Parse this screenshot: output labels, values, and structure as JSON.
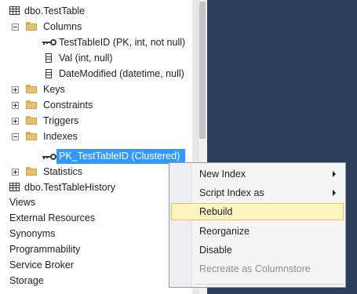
{
  "tree": {
    "table_name": "dbo.TestTable",
    "columns_folder": "Columns",
    "columns": [
      "TestTableID (PK, int, not null)",
      "Val (int, null)",
      "DateModified (datetime, null)"
    ],
    "keys_folder": "Keys",
    "constraints_folder": "Constraints",
    "triggers_folder": "Triggers",
    "indexes_folder": "Indexes",
    "selected_index": "PK_TestTableID (Clustered)",
    "statistics_folder": "Statistics",
    "history_table": "dbo.TestTableHistory",
    "nodes": [
      "Views",
      "External Resources",
      "Synonyms",
      "Programmability",
      "Service Broker",
      "Storage"
    ]
  },
  "context_menu": {
    "items": [
      "New Index",
      "Script Index as",
      "Rebuild",
      "Reorganize",
      "Disable",
      "Recreate as Columnstore"
    ],
    "highlighted": "Rebuild",
    "disabled": "Recreate as Columnstore"
  },
  "colors": {
    "selection": "#3399ff",
    "menu_highlight": "#fdf4bf",
    "dark_panel": "#2d3e5c"
  }
}
